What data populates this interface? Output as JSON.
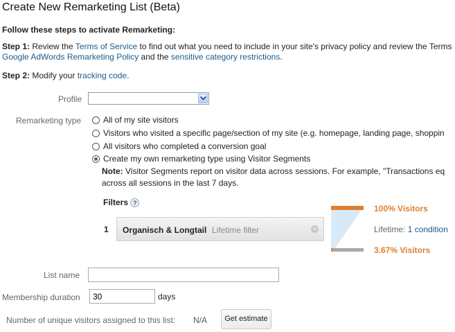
{
  "page": {
    "title": "Create New Remarketing List (Beta)"
  },
  "intro": {
    "heading": "Follow these steps to activate Remarketing:",
    "step1_label": "Step 1:",
    "step1_text_a": " Review the ",
    "tos_link": "Terms of Service",
    "step1_text_b": " to find out what you need to include in your site's privacy policy and review the Terms",
    "policy_link": "Google AdWords Remarketing Policy",
    "step1_text_c": " and the ",
    "restrictions_link": "sensitive category restrictions",
    "step1_text_d": ".",
    "step2_label": "Step 2:",
    "step2_text": " Modify your ",
    "tracking_link": "tracking code",
    "step2_text_end": "."
  },
  "form": {
    "profile_label": "Profile",
    "profile_value": "",
    "remarketing_type_label": "Remarketing type",
    "options": [
      "All of my site visitors",
      "Visitors who visited a specific page/section of my site (e.g. homepage, landing page, shoppin",
      "All visitors who completed a conversion goal",
      "Create my own remarketing type using Visitor Segments"
    ],
    "selected_option_index": 3,
    "note_label": "Note:",
    "note_text": " Visitor Segments report on visitor data across sessions. For example, \"Transactions eq",
    "note_text_2": "across all sessions in the last 7 days.",
    "filters_label": "Filters",
    "help_glyph": "?",
    "filter": {
      "index": "1",
      "name": "Organisch & Longtail",
      "scope": "Lifetime filter",
      "clear_glyph": "×"
    },
    "funnel": {
      "top_label": "100% Visitors",
      "lifetime_label": "Lifetime:",
      "condition_link": "1 condition",
      "bottom_label": "3.67% Visitors",
      "top_fraction": 1.0,
      "bottom_fraction": 0.0367
    },
    "list_name_label": "List name",
    "list_name_value": "",
    "membership_label": "Membership duration",
    "membership_value": "30",
    "membership_unit": "days",
    "unique_label": "Number of unique visitors assigned to this list:",
    "unique_value": "N/A",
    "estimate_button": "Get estimate"
  },
  "colors": {
    "link": "#1a5a8a",
    "accent_orange": "#e07f30",
    "funnel_light": "#d8eaf8",
    "funnel_bar_bottom": "#a9a9a9"
  }
}
